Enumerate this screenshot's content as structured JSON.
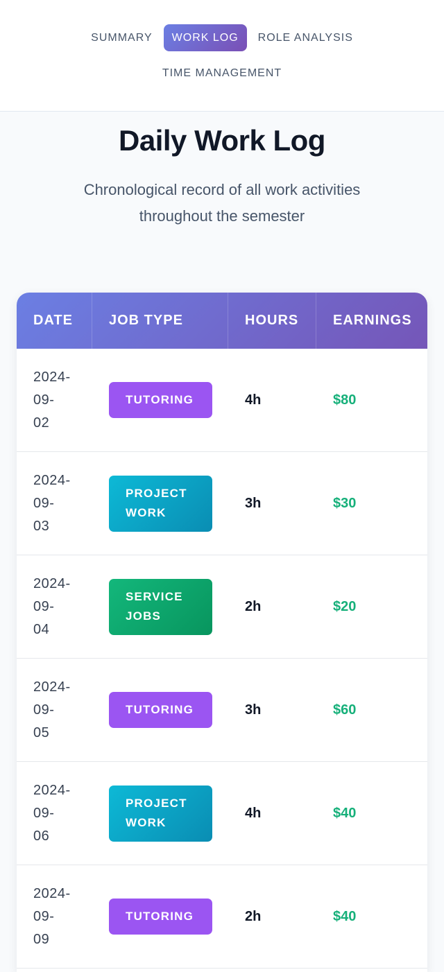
{
  "nav": {
    "items": [
      {
        "label": "SUMMARY"
      },
      {
        "label": "WORK LOG"
      },
      {
        "label": "ROLE ANALYSIS"
      },
      {
        "label": "TIME MANAGEMENT"
      }
    ],
    "active": "WORK LOG"
  },
  "hero": {
    "title": "Daily Work Log",
    "subtitle": "Chronological record of all work activities throughout the semester"
  },
  "table": {
    "headers": [
      "DATE",
      "JOB TYPE",
      "HOURS",
      "EARNINGS"
    ],
    "rows": [
      {
        "date": "2024-\n09-\n02",
        "job": "TUTORING",
        "hours": "4h",
        "earnings": "$80"
      },
      {
        "date": "2024-\n09-\n03",
        "job": "PROJECT WORK",
        "hours": "3h",
        "earnings": "$30"
      },
      {
        "date": "2024-\n09-\n04",
        "job": "SERVICE JOBS",
        "hours": "2h",
        "earnings": "$20"
      },
      {
        "date": "2024-\n09-\n05",
        "job": "TUTORING",
        "hours": "3h",
        "earnings": "$60"
      },
      {
        "date": "2024-\n09-\n06",
        "job": "PROJECT WORK",
        "hours": "4h",
        "earnings": "$40"
      },
      {
        "date": "2024-\n09-\n09",
        "job": "TUTORING",
        "hours": "2h",
        "earnings": "$40"
      }
    ]
  },
  "colors": {
    "accent_start": "#6b7fe3",
    "accent_end": "#7556b8",
    "tutoring": "#9b55f2",
    "project": "#0aa3c6",
    "service": "#10a86d",
    "earnings": "#16b07a"
  }
}
